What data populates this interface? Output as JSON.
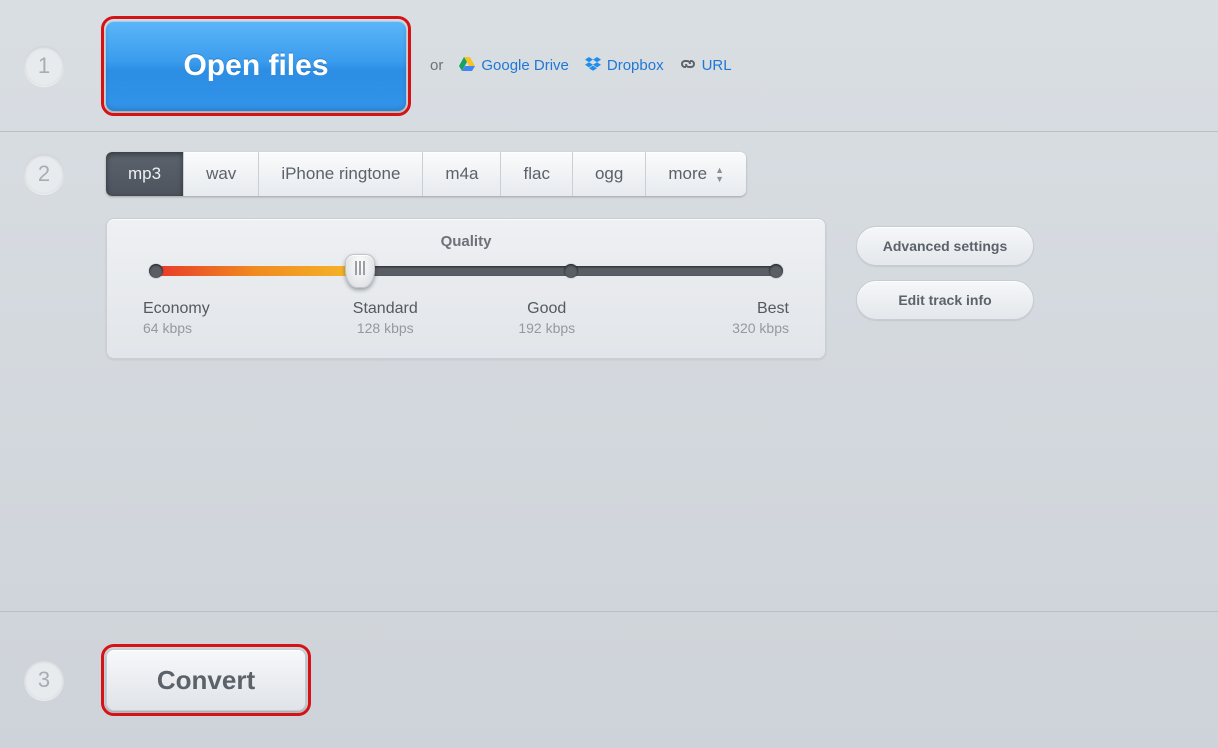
{
  "step1": {
    "num": "1",
    "open_label": "Open files",
    "or": "or",
    "google_drive": "Google Drive",
    "dropbox": "Dropbox",
    "url": "URL"
  },
  "step2": {
    "num": "2",
    "formats": {
      "mp3": "mp3",
      "wav": "wav",
      "iphone": "iPhone ringtone",
      "m4a": "m4a",
      "flac": "flac",
      "ogg": "ogg",
      "more": "more"
    },
    "quality": {
      "title": "Quality",
      "levels": [
        {
          "name": "Economy",
          "rate": "64 kbps"
        },
        {
          "name": "Standard",
          "rate": "128 kbps"
        },
        {
          "name": "Good",
          "rate": "192 kbps"
        },
        {
          "name": "Best",
          "rate": "320 kbps"
        }
      ],
      "selected_index": 1
    },
    "advanced": "Advanced settings",
    "edit_track": "Edit track info"
  },
  "step3": {
    "num": "3",
    "convert": "Convert"
  }
}
